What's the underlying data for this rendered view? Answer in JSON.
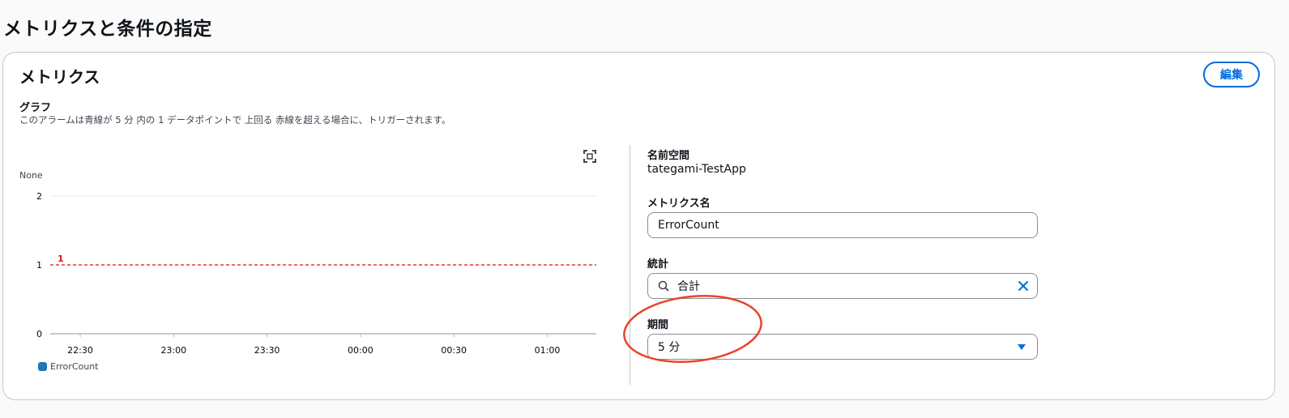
{
  "page": {
    "title": "メトリクスと条件の指定"
  },
  "card": {
    "title": "メトリクス",
    "edit_label": "編集",
    "graph_label": "グラフ",
    "graph_description": "このアラームは青線が 5 分 内の 1 データポイントで 上回る 赤線を超える場合に、トリガーされます。"
  },
  "chart_data": {
    "type": "line",
    "ylabel": "None",
    "ylim": [
      0,
      2
    ],
    "yticks": [
      "2",
      "1",
      "0"
    ],
    "x": [
      "22:30",
      "23:00",
      "23:30",
      "00:00",
      "00:30",
      "01:00"
    ],
    "series": [
      {
        "name": "ErrorCount",
        "values": []
      }
    ],
    "threshold": {
      "value": 1,
      "label": "1",
      "color": "#d91515"
    },
    "series_color": "#1f77b4"
  },
  "fields": {
    "namespace_label": "名前空間",
    "namespace_value": "tategami-TestApp",
    "metric_name_label": "メトリクス名",
    "metric_name_value": "ErrorCount",
    "statistic_label": "統計",
    "statistic_value": "合計",
    "period_label": "期間",
    "period_value": "5 分"
  },
  "colors": {
    "accent": "#006ce0",
    "annotation": "#e8442b"
  }
}
